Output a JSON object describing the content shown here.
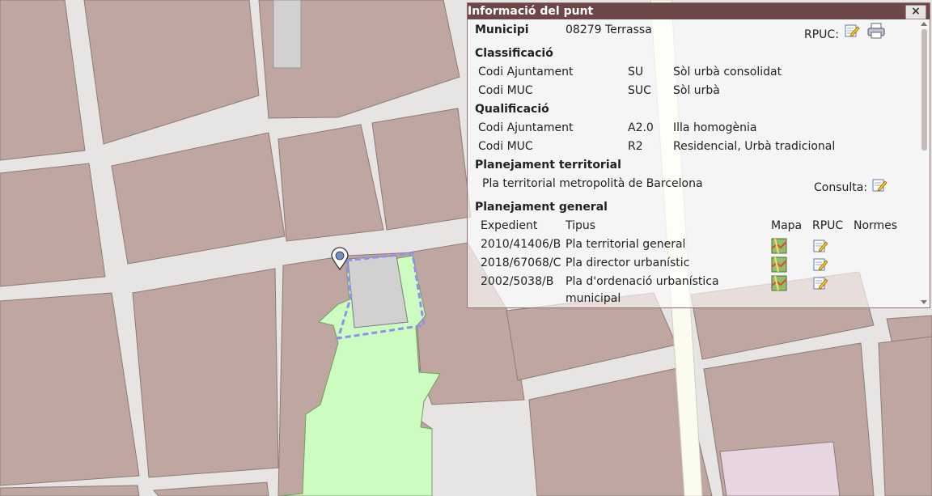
{
  "popup": {
    "title": "Informació del punt",
    "close_label": "×",
    "municipi_label": "Municipi",
    "municipi_value": "08279 Terrassa",
    "rpuc_label": "RPUC:",
    "classificacio": {
      "heading": "Classificació",
      "rows": [
        {
          "label": "Codi Ajuntament",
          "code": "SU",
          "description": "Sòl urbà consolidat"
        },
        {
          "label": "Codi MUC",
          "code": "SUC",
          "description": "Sòl urbà"
        }
      ]
    },
    "qualificacio": {
      "heading": "Qualificació",
      "rows": [
        {
          "label": "Codi Ajuntament",
          "code": "A2.0",
          "description": "Illa homogènia"
        },
        {
          "label": "Codi MUC",
          "code": "R2",
          "description": "Residencial, Urbà tradicional"
        }
      ]
    },
    "planejament_territorial": {
      "heading": "Planejament territorial",
      "plan": "Pla territorial metropolità de Barcelona",
      "consulta_label": "Consulta:"
    },
    "planejament_general": {
      "heading": "Planejament general",
      "columns": [
        "Expedient",
        "Tipus",
        "Mapa",
        "RPUC",
        "Normes"
      ],
      "rows": [
        {
          "expedient": "2010/41406/B",
          "tipus": "Pla territorial general",
          "tipus2": ""
        },
        {
          "expedient": "2018/67068/C",
          "tipus": "Pla director urbanístic",
          "tipus2": ""
        },
        {
          "expedient": "2002/5038/B",
          "tipus": "Pla d'ordenació urbanística",
          "tipus2": "municipal"
        }
      ]
    }
  },
  "icons": {
    "edit": "edit-document-icon",
    "print": "printer-icon",
    "map": "map-icon",
    "marker": "location-marker-icon"
  },
  "colors": {
    "block": "#bfa6a1",
    "street": "#e7e5e4",
    "green_zone": "#cdfcc0",
    "building": "#d2d0d0",
    "selection": "#8f8ff0",
    "popup_header": "#6d4747",
    "pink_block": "#e8d5e2"
  }
}
